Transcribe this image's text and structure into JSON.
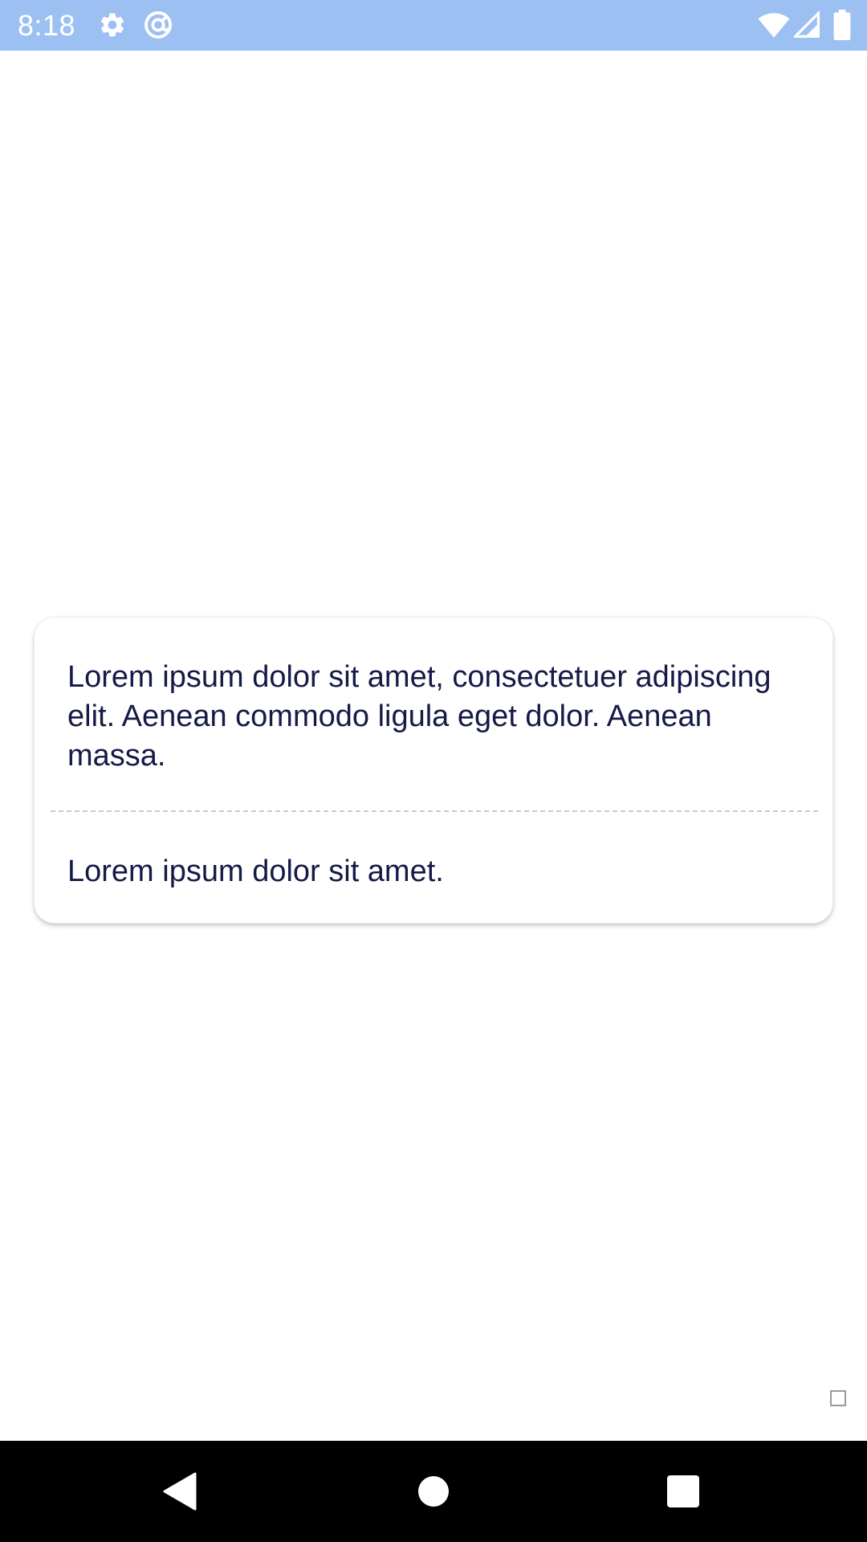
{
  "status_bar": {
    "time": "8:18",
    "background_color": "#9dc0f3",
    "left_icons": [
      "gear-icon",
      "at-sign-icon"
    ],
    "right_icons": [
      "wifi-icon",
      "cellular-signal-icon",
      "battery-icon"
    ]
  },
  "card": {
    "paragraph": "Lorem ipsum dolor sit amet, consectetuer adipiscing elit. Aenean commodo ligula eget dolor. Aenean massa.",
    "footer_text": "Lorem ipsum dolor sit amet.",
    "text_color": "#151a46"
  },
  "nav_bar": {
    "buttons": [
      "back-icon",
      "home-icon",
      "recents-icon"
    ]
  }
}
